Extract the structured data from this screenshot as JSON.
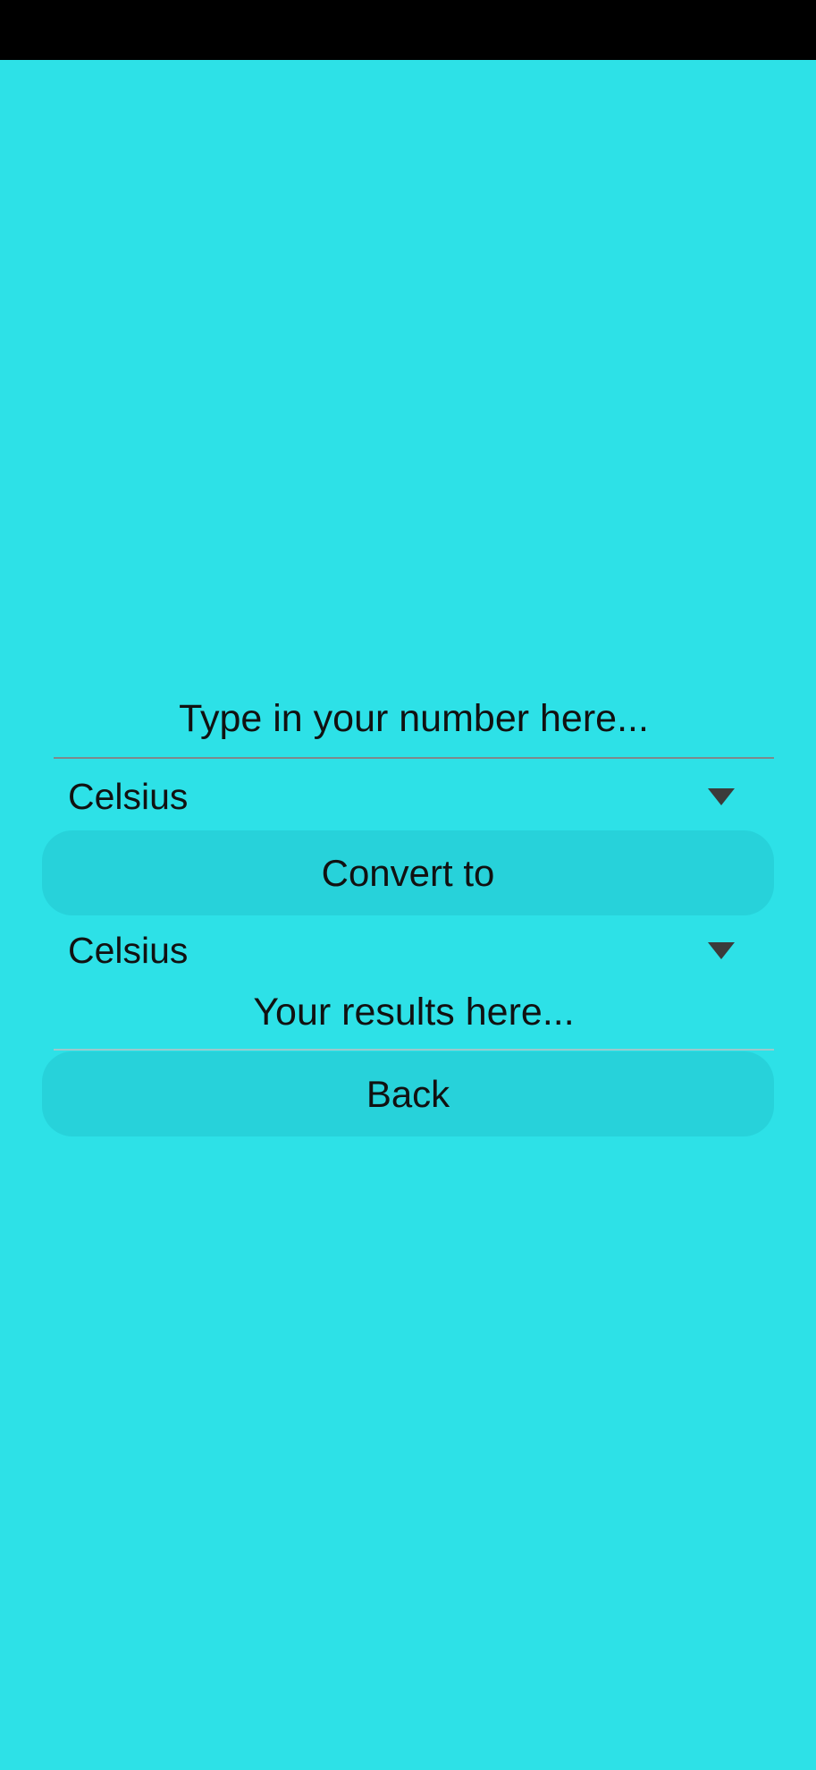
{
  "input": {
    "value": "",
    "placeholder": "Type in your number here..."
  },
  "from_unit": {
    "selected": "Celsius",
    "icon": "dropdown-triangle-icon"
  },
  "convert_button": {
    "label": "Convert to"
  },
  "to_unit": {
    "selected": "Celsius",
    "icon": "dropdown-triangle-icon"
  },
  "result": {
    "text": "Your results here..."
  },
  "back_button": {
    "label": "Back"
  },
  "colors": {
    "background": "#2de1e7",
    "button": "#27d2da",
    "status_bar": "#000000",
    "text": "#111111"
  }
}
